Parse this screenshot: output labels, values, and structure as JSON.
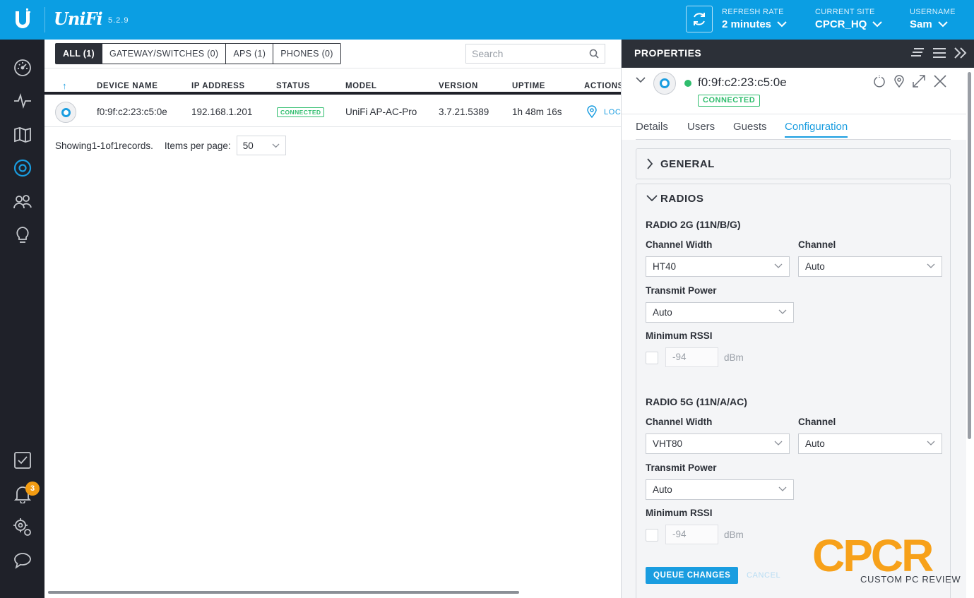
{
  "app": {
    "logo_text": "UniFi",
    "version": "5.2.9"
  },
  "header": {
    "refresh_label": "REFRESH RATE",
    "refresh_value": "2 minutes",
    "site_label": "CURRENT SITE",
    "site_value": "CPCR_HQ",
    "user_label": "USERNAME",
    "user_value": "Sam"
  },
  "sidebar": {
    "items": [
      {
        "name": "dashboard-icon"
      },
      {
        "name": "statistics-icon"
      },
      {
        "name": "map-icon"
      },
      {
        "name": "devices-icon",
        "active": true
      },
      {
        "name": "clients-icon"
      },
      {
        "name": "insights-icon"
      },
      {
        "name": "tasks-icon"
      },
      {
        "name": "alerts-icon"
      },
      {
        "name": "settings-icon"
      },
      {
        "name": "chat-icon"
      }
    ],
    "alerts_badge": "3"
  },
  "main": {
    "filters": [
      {
        "label": "ALL (1)",
        "active": true
      },
      {
        "label": "GATEWAY/SWITCHES (0)"
      },
      {
        "label": "APS (1)"
      },
      {
        "label": "PHONES (0)"
      }
    ],
    "search_placeholder": "Search",
    "columns": [
      "↑",
      "DEVICE NAME",
      "IP ADDRESS",
      "STATUS",
      "MODEL",
      "VERSION",
      "UPTIME",
      "ACTIONS"
    ],
    "rows": [
      {
        "device_name": "f0:9f:c2:23:c5:0e",
        "ip": "192.168.1.201",
        "status": "CONNECTED",
        "model": "UniFi AP-AC-Pro",
        "version": "3.7.21.5389",
        "uptime": "1h 48m 16s",
        "action": "LOC"
      }
    ],
    "paging": {
      "showing_prefix": "Showing ",
      "range": "1-1",
      "of_word": " of ",
      "total": "1",
      "suffix": " records.",
      "per_page_label": "Items per page:",
      "per_page_value": "50"
    }
  },
  "panel": {
    "title": "PROPERTIES",
    "device": {
      "name": "f0:9f:c2:23:c5:0e",
      "status": "CONNECTED"
    },
    "tabs": [
      {
        "label": "Details"
      },
      {
        "label": "Users"
      },
      {
        "label": "Guests"
      },
      {
        "label": "Configuration",
        "active": true
      }
    ],
    "general_title": "GENERAL",
    "radios_title": "RADIOS",
    "radio2g": {
      "title": "RADIO 2G (11N/B/G)",
      "channel_width_label": "Channel Width",
      "channel_width": "HT40",
      "channel_label": "Channel",
      "channel": "Auto",
      "tx_power_label": "Transmit Power",
      "tx_power": "Auto",
      "rssi_label": "Minimum RSSI",
      "rssi_value": "-94",
      "rssi_unit": "dBm"
    },
    "radio5g": {
      "title": "RADIO 5G (11N/A/AC)",
      "channel_width_label": "Channel Width",
      "channel_width": "VHT80",
      "channel_label": "Channel",
      "channel": "Auto",
      "tx_power_label": "Transmit Power",
      "tx_power": "Auto",
      "rssi_label": "Minimum RSSI",
      "rssi_value": "-94",
      "rssi_unit": "dBm"
    },
    "queue_button": "QUEUE CHANGES",
    "cancel_button": "CANCEL"
  },
  "watermark": {
    "letters": "CPCR",
    "subtitle": "CUSTOM PC REVIEW"
  },
  "colors": {
    "topbar": "#0b9ee3",
    "sidebar": "#1f2129",
    "accent": "#1a9de0",
    "connected": "#2fbd6d",
    "badge": "#f39c12",
    "watermark": "#f7a11a"
  }
}
